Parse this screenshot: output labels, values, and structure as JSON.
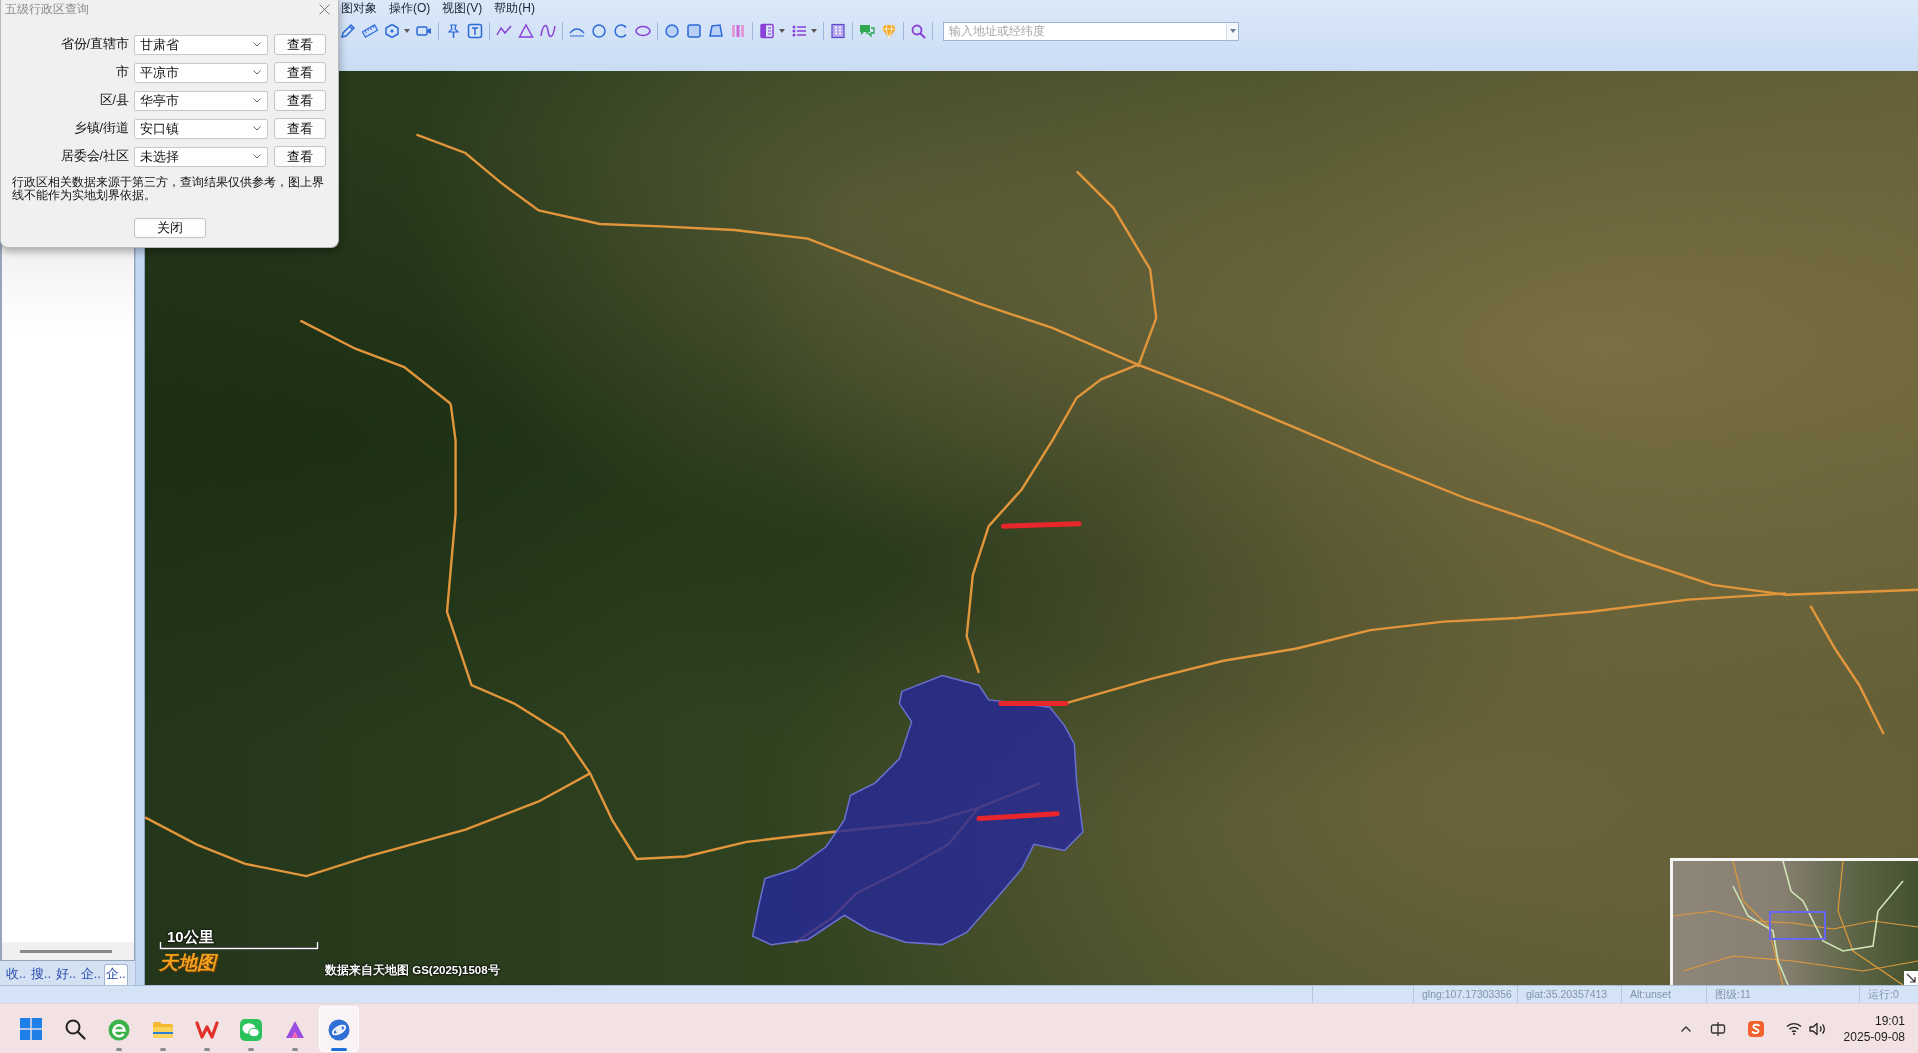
{
  "menu": [
    "图对象",
    "操作(O)",
    "视图(V)",
    "帮助(H)"
  ],
  "toolbar": {
    "address_search": {
      "placeholder": "输入地址或经纬度"
    }
  },
  "dialog": {
    "title": "五级行政区查询",
    "rows": [
      {
        "label": "省份/直辖市",
        "value": "甘肃省",
        "button": "查看"
      },
      {
        "label": "市",
        "value": "平凉市",
        "button": "查看"
      },
      {
        "label": "区/县",
        "value": "华亭市",
        "button": "查看"
      },
      {
        "label": "乡镇/街道",
        "value": "安口镇",
        "button": "查看"
      },
      {
        "label": "居委会/社区",
        "value": "未选择",
        "button": "查看"
      }
    ],
    "note": "行政区相关数据来源于第三方，查询结果仅供参考，图上界线不能作为实地划界依据。",
    "close_button": "关闭"
  },
  "sidebar": {
    "tabs": [
      {
        "label": "收..",
        "selected": false
      },
      {
        "label": "搜..",
        "selected": false
      },
      {
        "label": "好..",
        "selected": false
      },
      {
        "label": "企..",
        "selected": false
      },
      {
        "label": "企..",
        "selected": true
      }
    ]
  },
  "map": {
    "scale_label": "10公里",
    "logo": "天地图",
    "attribution": "数据来自天地图 GS(2025)1508号"
  },
  "status_bar": [
    "glng:107.17303356",
    "glat:35.20357413",
    "Alt:unset",
    "图级:11",
    "运行:0"
  ],
  "taskbar": {
    "apps": [
      {
        "kind": "browser",
        "selected": false
      },
      {
        "kind": "folder",
        "selected": false
      },
      {
        "kind": "office",
        "selected": false
      },
      {
        "kind": "chat",
        "selected": false
      },
      {
        "kind": "design",
        "selected": false
      },
      {
        "kind": "globe",
        "selected": true
      }
    ],
    "clock": {
      "time": "19:01",
      "date": "2025-09-08"
    }
  }
}
